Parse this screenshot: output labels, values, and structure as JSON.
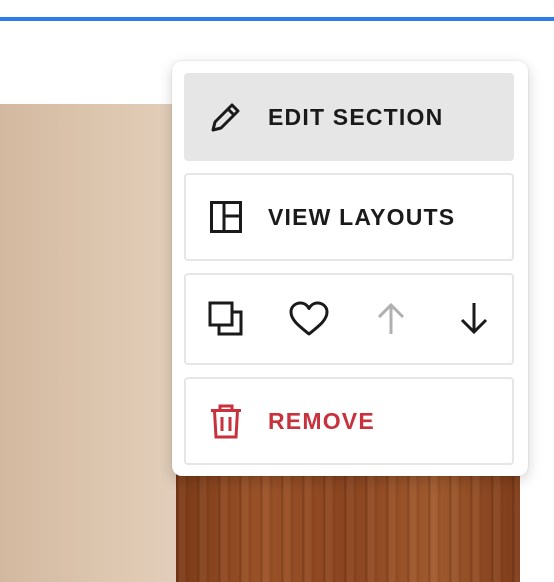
{
  "colors": {
    "accent_bar": "#2b7de9",
    "text": "#1a1a1a",
    "danger": "#c8323c",
    "disabled": "#b0b0b0",
    "active_bg": "#e6e6e6"
  },
  "menu": {
    "items": [
      {
        "label": "EDIT SECTION",
        "icon": "pencil-icon",
        "active": true
      },
      {
        "label": "VIEW LAYOUTS",
        "icon": "layout-icon",
        "active": false
      },
      {
        "label": "REMOVE",
        "icon": "trash-icon",
        "active": false
      }
    ],
    "tools": [
      {
        "icon": "duplicate-icon",
        "enabled": true
      },
      {
        "icon": "heart-icon",
        "enabled": true
      },
      {
        "icon": "arrow-up-icon",
        "enabled": false
      },
      {
        "icon": "arrow-down-icon",
        "enabled": true
      }
    ]
  }
}
